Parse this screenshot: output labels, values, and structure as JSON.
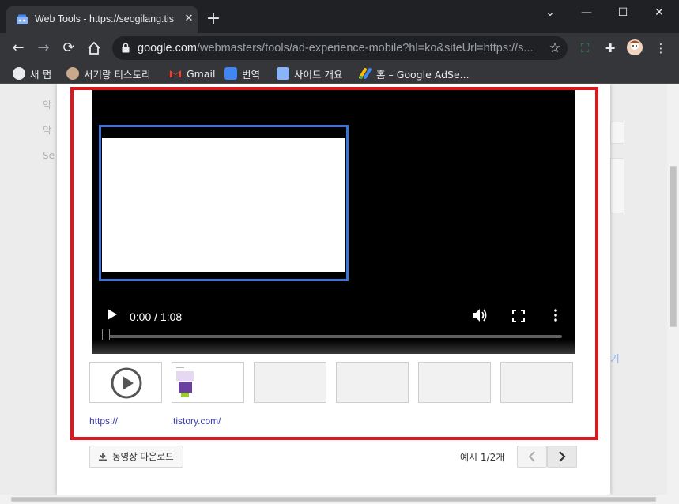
{
  "browser": {
    "tab_title": "Web Tools - https://seogilang.tis",
    "tab_close": "✕",
    "new_tab": "+",
    "window": {
      "minimize": "⌄",
      "restore": "—",
      "maximize": "☐",
      "close": "✕"
    },
    "url_host": "google.com",
    "url_path": "/webmasters/tools/ad-experience-mobile?hl=ko&siteUrl=https://s...",
    "bookmarks": [
      {
        "label": "새 탭",
        "icon": "globe-icon",
        "color": "#e8eaed"
      },
      {
        "label": "서기랑 티스토리",
        "icon": "avatar-icon",
        "color": "#c9a98b"
      },
      {
        "label": "Gmail",
        "icon": "gmail-icon",
        "color": "#ea4335"
      },
      {
        "label": "번역",
        "icon": "translate-icon",
        "color": "#4285f4"
      },
      {
        "label": "사이트 개요",
        "icon": "store-icon",
        "color": "#8ab4f8"
      },
      {
        "label": "홈 – Google AdSe...",
        "icon": "adsense-icon",
        "color": "#fbbc04"
      }
    ]
  },
  "background": {
    "left_ghost": [
      "악",
      "악",
      "Se"
    ],
    "right_ghost": "기"
  },
  "player": {
    "time": "0:00 / 1:08",
    "progress": 0
  },
  "thumbnails": [
    {
      "kind": "play",
      "active": true
    },
    {
      "kind": "screenshot",
      "active": true
    },
    {
      "kind": "empty",
      "active": false
    },
    {
      "kind": "empty",
      "active": false
    },
    {
      "kind": "empty",
      "active": false
    },
    {
      "kind": "empty",
      "active": false
    }
  ],
  "site_url": "https://                    .tistory.com/",
  "footer": {
    "download_label": "동영상 다운로드",
    "pager_label": "예시 1/2개"
  },
  "colors": {
    "highlight": "#e0161e",
    "frame_border": "#3b73d9"
  }
}
